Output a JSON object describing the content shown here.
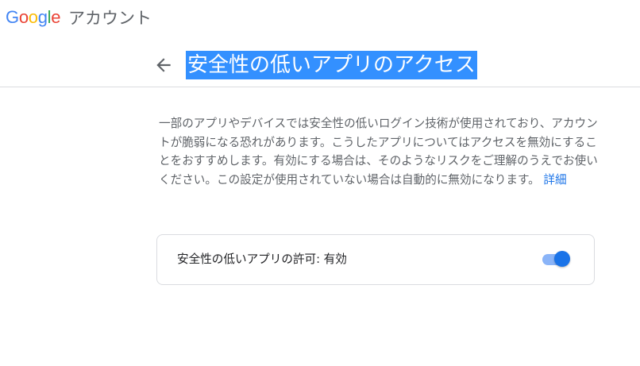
{
  "header": {
    "logo_letters": [
      {
        "char": "G",
        "color": "#4285F4"
      },
      {
        "char": "o",
        "color": "#EA4335"
      },
      {
        "char": "o",
        "color": "#FBBC05"
      },
      {
        "char": "g",
        "color": "#4285F4"
      },
      {
        "char": "l",
        "color": "#34A853"
      },
      {
        "char": "e",
        "color": "#EA4335"
      }
    ],
    "product_name": "アカウント"
  },
  "title_row": {
    "back_icon": "arrow-left-icon",
    "title": "安全性の低いアプリのアクセス",
    "title_selected": true
  },
  "description": {
    "text": "一部のアプリやデバイスでは安全性の低いログイン技術が使用されており、アカウントが脆弱になる恐れがあります。こうしたアプリについてはアクセスを無効にすることをおすすめします。有効にする場合は、そのようなリスクをご理解のうえでお使いください。この設定が使用されていない場合は自動的に無効になります。",
    "link_label": "詳細"
  },
  "setting_card": {
    "label": "安全性の低いアプリの許可: 有効",
    "toggle_on": true
  },
  "colors": {
    "accent": "#1a73e8",
    "selection": "#3390ff",
    "toggle_track": "#8ab4f8"
  }
}
